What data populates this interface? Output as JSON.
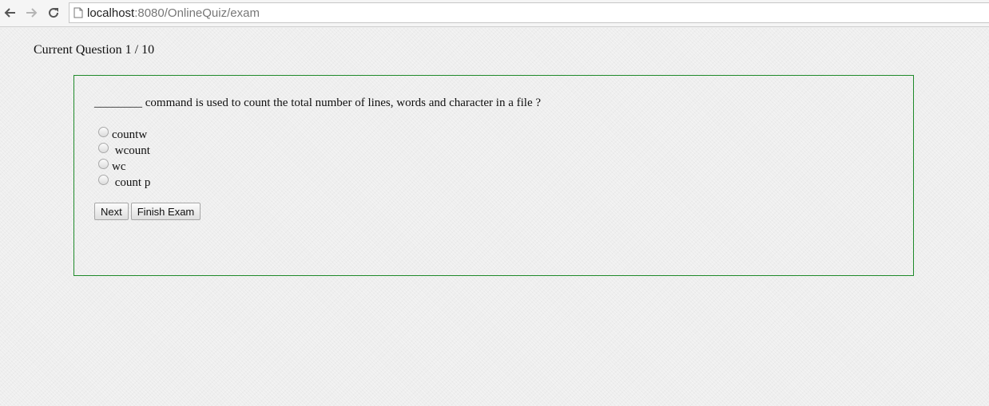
{
  "browser": {
    "url_host": "localhost",
    "url_path": ":8080/OnlineQuiz/exam"
  },
  "quiz": {
    "current_question_label": "Current Question 1 / 10",
    "question_text": "________ command is used to count the total number of lines, words and character in a file ?",
    "options": [
      {
        "label": "countw"
      },
      {
        "label": " wcount"
      },
      {
        "label": "wc"
      },
      {
        "label": " count p"
      }
    ],
    "next_label": "Next",
    "finish_label": "Finish Exam",
    "box_border_color": "#1f8a2a"
  }
}
